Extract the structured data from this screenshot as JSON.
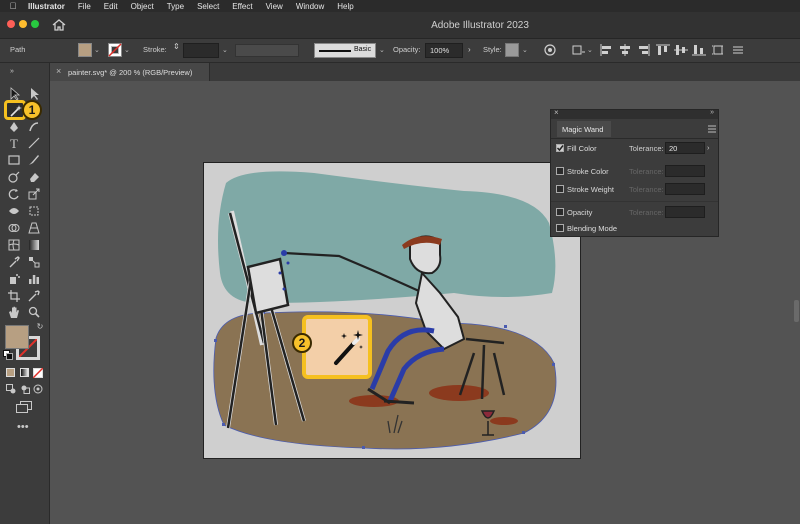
{
  "menubar": {
    "app_name": "Illustrator",
    "items": [
      "File",
      "Edit",
      "Object",
      "Type",
      "Select",
      "Effect",
      "View",
      "Window",
      "Help"
    ]
  },
  "window": {
    "title": "Adobe Illustrator 2023"
  },
  "controlbar": {
    "selection_label": "Path",
    "stroke_label": "Stroke:",
    "brush_label": "Basic",
    "opacity_label": "Opacity:",
    "opacity_value": "100%",
    "style_label": "Style:"
  },
  "document": {
    "tab_title": "painter.svg* @ 200 % (RGB/Preview)"
  },
  "toolbar": {
    "fill_color": "#b79f82"
  },
  "magic_wand": {
    "panel_title": "Magic Wand",
    "rows": [
      {
        "label": "Fill Color",
        "checked": true,
        "tolerance_label": "Tolerance:",
        "tolerance": "20"
      },
      {
        "label": "Stroke Color",
        "checked": false,
        "tolerance_label": "Tolerance:",
        "tolerance": ""
      },
      {
        "label": "Stroke Weight",
        "checked": false,
        "tolerance_label": "Tolerance:",
        "tolerance": ""
      },
      {
        "label": "Opacity",
        "checked": false,
        "tolerance_label": "Tolerance:",
        "tolerance": ""
      },
      {
        "label": "Blending Mode",
        "checked": false
      }
    ]
  },
  "callouts": {
    "step1": "1",
    "step2": "2"
  },
  "colors": {
    "accent_yellow": "#f5c020",
    "callout_fill": "#f3cfa8"
  }
}
